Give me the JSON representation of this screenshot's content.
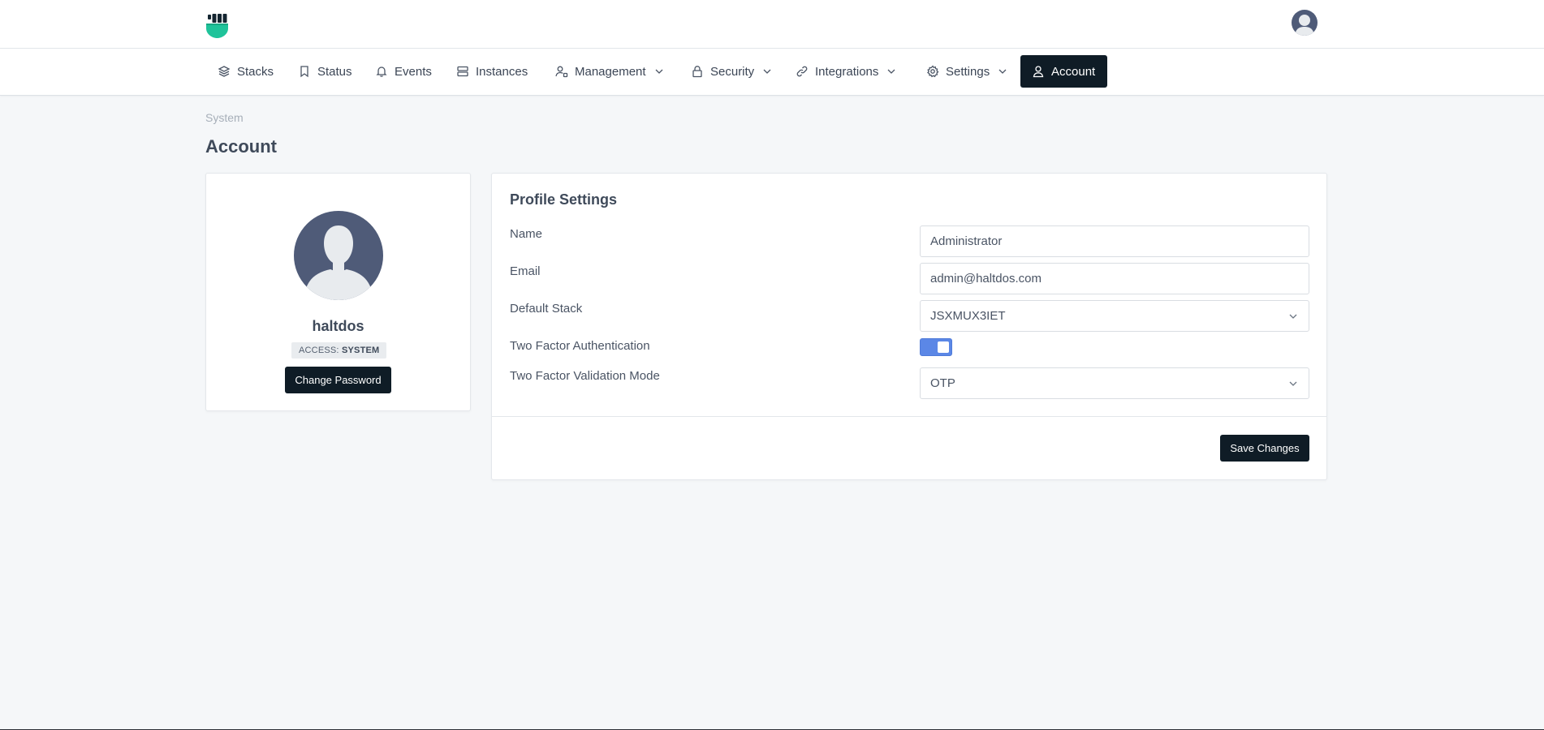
{
  "nav": {
    "items": [
      {
        "label": "Stacks"
      },
      {
        "label": "Status"
      },
      {
        "label": "Events"
      },
      {
        "label": "Instances"
      },
      {
        "label": "Management"
      },
      {
        "label": "Security"
      },
      {
        "label": "Integrations"
      },
      {
        "label": "Settings"
      },
      {
        "label": "Account"
      }
    ],
    "active": "Account"
  },
  "breadcrumb": "System",
  "page_title": "Account",
  "profile": {
    "username": "haltdos",
    "access_label": "ACCESS:",
    "access_value": "SYSTEM",
    "change_password_label": "Change Password"
  },
  "settings": {
    "title": "Profile Settings",
    "name_label": "Name",
    "name_value": "Administrator",
    "email_label": "Email",
    "email_value": "admin@haltdos.com",
    "default_stack_label": "Default Stack",
    "default_stack_value": "JSXMUX3IET",
    "two_factor_label": "Two Factor Authentication",
    "two_factor_enabled": true,
    "validation_mode_label": "Two Factor Validation Mode",
    "validation_mode_value": "OTP",
    "save_label": "Save Changes"
  },
  "colors": {
    "accent_dark": "#0f1c26",
    "toggle_on": "#5b87e6",
    "logo_green": "#1fc39a",
    "avatar_body": "#4f5b78"
  },
  "icons": {
    "stacks": "layers-icon",
    "status": "bookmark-icon",
    "events": "bell-icon",
    "instances": "server-icon",
    "management": "user-cog-icon",
    "security": "lock-icon",
    "integrations": "link-icon",
    "settings": "gear-icon",
    "account": "user-icon"
  }
}
